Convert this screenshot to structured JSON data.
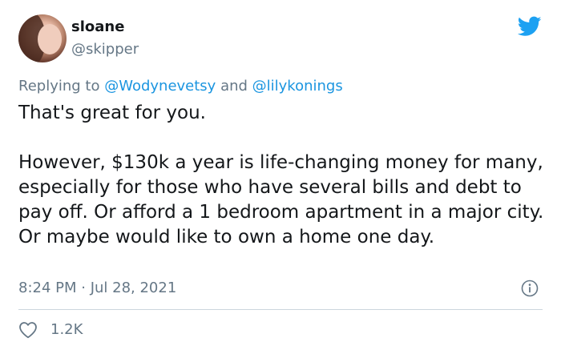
{
  "author": {
    "display_name": "sloane",
    "handle": "@skipper"
  },
  "reply": {
    "prefix": "Replying to ",
    "mention_1": "@Wodynevetsy",
    "joiner": " and ",
    "mention_2": "@lilykonings"
  },
  "tweet": {
    "line_1": "That's great for you.",
    "line_2": "However, $130k a year is life-changing money for many, especially for those who have several bills and debt to pay off. Or afford a 1 bedroom apartment in a major city. Or maybe would like to own a home one day."
  },
  "meta": {
    "timestamp": "8:24 PM · Jul 28, 2021"
  },
  "engagement": {
    "likes": "1.2K"
  },
  "colors": {
    "brand": "#1da1f2",
    "link": "#1b95e0",
    "secondary_text": "#657786",
    "divider": "#ccd6dd"
  },
  "icons": {
    "brand": "twitter-bird-icon",
    "info": "info-icon",
    "like": "heart-outline-icon"
  }
}
